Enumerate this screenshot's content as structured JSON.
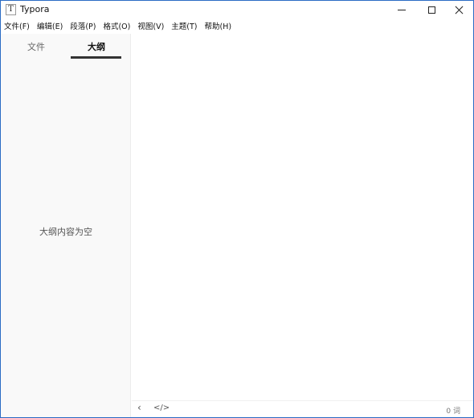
{
  "window": {
    "title": "Typora",
    "icon_letter": "T",
    "controls": {
      "minimize": "minimize",
      "maximize": "maximize",
      "close": "close"
    }
  },
  "menubar": {
    "items": [
      {
        "label": "文件(F)"
      },
      {
        "label": "编辑(E)"
      },
      {
        "label": "段落(P)"
      },
      {
        "label": "格式(O)"
      },
      {
        "label": "视图(V)"
      },
      {
        "label": "主题(T)"
      },
      {
        "label": "帮助(H)"
      }
    ]
  },
  "sidebar": {
    "tabs": [
      {
        "label": "文件",
        "active": false
      },
      {
        "label": "大纲",
        "active": true
      }
    ],
    "empty_message": "大纲内容为空"
  },
  "statusbar": {
    "back_icon": "‹",
    "source_icon": "</>",
    "word_count": "0 词"
  },
  "colors": {
    "window_border": "#2b6cc4",
    "sidebar_bg": "#f9f9f9",
    "active_tab_underline": "#333333"
  }
}
